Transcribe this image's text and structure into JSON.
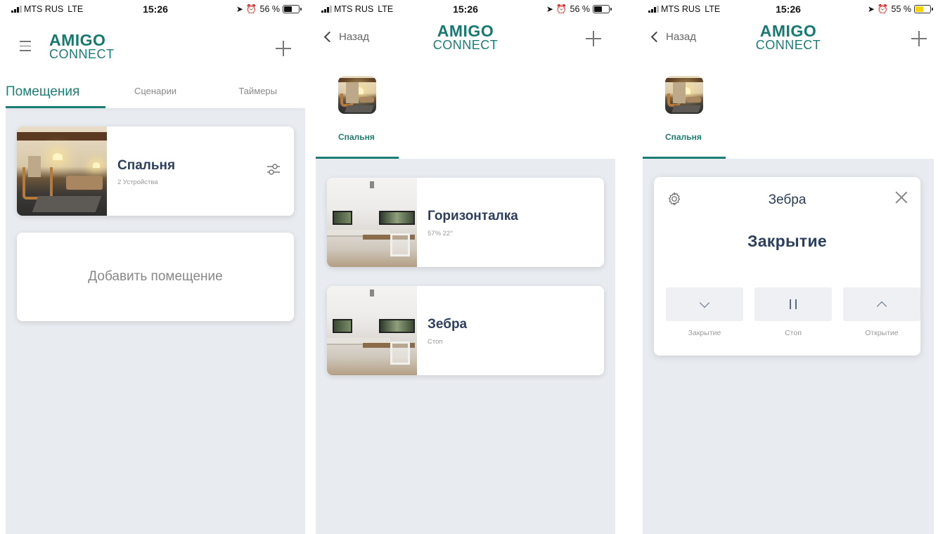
{
  "status_bars": [
    {
      "carrier": "MTS RUS",
      "network": "LTE",
      "time": "15:26",
      "battery": "56 %",
      "battery_color": "#111111"
    },
    {
      "carrier": "MTS RUS",
      "network": "LTE",
      "time": "15:26",
      "battery": "56 %",
      "battery_color": "#111111"
    },
    {
      "carrier": "MTS RUS",
      "network": "LTE",
      "time": "15:26",
      "battery": "55 %",
      "battery_color": "#f5d40b"
    }
  ],
  "logo": {
    "top": "AMIGO",
    "bottom": "CONNECT"
  },
  "colors": {
    "accent": "#1c7d74",
    "title_text": "#2d3f5c",
    "background": "#e8ebef"
  },
  "screen1": {
    "tabs": [
      "Помещения",
      "Сценарии",
      "Таймеры"
    ],
    "room_card": {
      "title": "Спальня",
      "subtitle": "2 Устройства"
    },
    "add_room": "Добавить помещение"
  },
  "screen2": {
    "back": "Назад",
    "room_tab": "Спальня",
    "devices": [
      {
        "title": "Горизонталка",
        "subtitle": "57% 22°"
      },
      {
        "title": "Зебра",
        "subtitle": "Стоп"
      }
    ]
  },
  "screen3": {
    "back": "Назад",
    "room_tab": "Спальня",
    "panel": {
      "title": "Зебра",
      "status": "Закрытие",
      "controls": [
        "Закрытие",
        "Стоп",
        "Открытие"
      ]
    }
  },
  "icons": {
    "menu": "menu-icon",
    "add": "plus-icon",
    "back": "chevron-left-icon",
    "settings": "sliders-icon",
    "gear": "gear-icon",
    "close": "close-icon",
    "down": "chevron-down-icon",
    "pause": "pause-icon",
    "up": "chevron-up-icon"
  }
}
